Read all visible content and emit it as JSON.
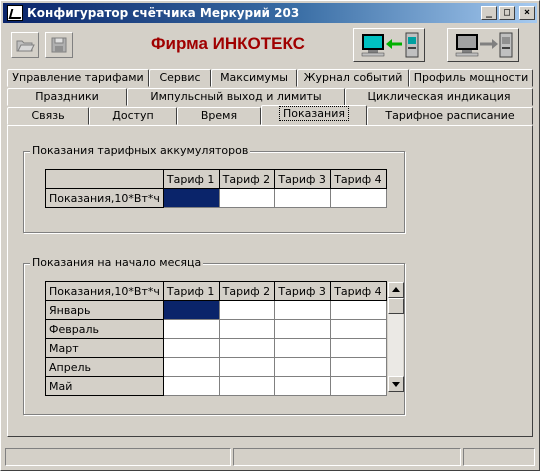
{
  "window": {
    "title": "Конфигуратор счётчика Меркурий 203",
    "minimize_glyph": "_",
    "maximize_glyph": "□",
    "close_glyph": "×"
  },
  "toolbar": {
    "brand": "Фирма ИНКОТЕКС",
    "icons": [
      "open-folder-icon",
      "save-disk-icon",
      "connect-icon",
      "disconnect-icon"
    ]
  },
  "tabs": {
    "row1": [
      "Управление тарифами",
      "Сервис",
      "Максимумы",
      "Журнал событий",
      "Профиль мощности"
    ],
    "row2": [
      "Праздники",
      "Импульсный выход и лимиты",
      "Циклическая индикация"
    ],
    "row3": [
      "Связь",
      "Доступ",
      "Время",
      "Показания",
      "Тарифное расписание"
    ],
    "active": "Показания"
  },
  "accumulators": {
    "title": "Показания тарифных аккумуляторов",
    "headers": [
      "",
      "Тариф 1",
      "Тариф 2",
      "Тариф 3",
      "Тариф 4"
    ],
    "row_label": "Показания,10*Вт*ч",
    "values": [
      "",
      "",
      "",
      ""
    ]
  },
  "monthly": {
    "title": "Показания на начало месяца",
    "headers": [
      "Показания,10*Вт*ч",
      "Тариф 1",
      "Тариф 2",
      "Тариф 3",
      "Тариф 4"
    ],
    "rows": [
      {
        "month": "Январь",
        "values": [
          "",
          "",
          "",
          ""
        ]
      },
      {
        "month": "Февраль",
        "values": [
          "",
          "",
          "",
          ""
        ]
      },
      {
        "month": "Март",
        "values": [
          "",
          "",
          "",
          ""
        ]
      },
      {
        "month": "Апрель",
        "values": [
          "",
          "",
          "",
          ""
        ]
      },
      {
        "month": "Май",
        "values": [
          "",
          "",
          "",
          ""
        ]
      }
    ]
  },
  "statusbar": [
    "",
    "",
    ""
  ],
  "colors": {
    "title_gradient_start": "#0a246a",
    "brand": "#a00000",
    "selected_cell": "#0a246a",
    "connect_arrow": "#00b000"
  }
}
